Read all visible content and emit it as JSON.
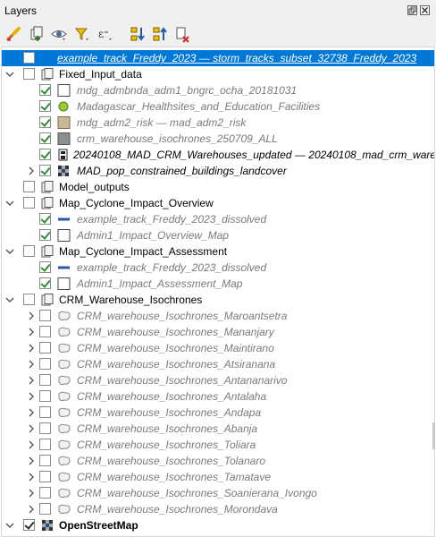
{
  "panel": {
    "title": "Layers"
  },
  "colors": {
    "selection": "#0078d7",
    "group_text": "#000000",
    "hidden_layer_text": "#7a7a7a"
  },
  "toolbar": {
    "tools": [
      {
        "name": "style-brush-icon"
      },
      {
        "name": "add-group-icon"
      },
      {
        "name": "visibility-eye-icon"
      },
      {
        "name": "filter-icon"
      },
      {
        "name": "expression-filter-icon"
      },
      {
        "name": "expand-all-icon"
      },
      {
        "name": "collapse-all-icon"
      },
      {
        "name": "remove-layer-icon"
      }
    ]
  },
  "tree": {
    "rows": [
      {
        "label": "example_track_Freddy_2023 — storm_tracks_subset_32738_Freddy_2023",
        "selected": true
      },
      {
        "label": "Fixed_Input_data"
      },
      {
        "label": "mdg_admbnda_adm1_bngrc_ocha_20181031"
      },
      {
        "label": "Madagascar_Healthsites_and_Education_Facilities"
      },
      {
        "label": "mdg_adm2_risk — mad_adm2_risk"
      },
      {
        "label": "crm_warehouse_isochrones_250709_ALL"
      },
      {
        "label": "20240108_MAD_CRM_Warehouses_updated — 20240108_mad_crm_warehouses_updated"
      },
      {
        "label": "MAD_pop_constrained_buildings_landcover"
      },
      {
        "label": "Model_outputs"
      },
      {
        "label": "Map_Cyclone_Impact_Overview"
      },
      {
        "label": "example_track_Freddy_2023_dissolved"
      },
      {
        "label": "Admin1_Impact_Overview_Map"
      },
      {
        "label": "Map_Cyclone_Impact_Assessment"
      },
      {
        "label": "example_track_Freddy_2023_dissolved"
      },
      {
        "label": "Admin1_Impact_Assessment_Map"
      },
      {
        "label": "CRM_Warehouse_Isochrones"
      },
      {
        "label": "CRM_warehouse_Isochrones_Maroantsetra"
      },
      {
        "label": "CRM_warehouse_Isochrones_Mananjary"
      },
      {
        "label": "CRM_warehouse_Isochrones_Maintirano"
      },
      {
        "label": "CRM_warehouse_Isochrones_Atsiranana"
      },
      {
        "label": "CRM_warehouse_Isochrones_Antananarivo"
      },
      {
        "label": "CRM_warehouse_Isochrones_Antalaha"
      },
      {
        "label": "CRM_warehouse_Isochrones_Andapa"
      },
      {
        "label": "CRM_warehouse_Isochrones_Abanja"
      },
      {
        "label": "CRM_warehouse_Isochrones_Toliara"
      },
      {
        "label": "CRM_warehouse_Isochrones_Tolanaro"
      },
      {
        "label": "CRM_warehouse_Isochrones_Tamatave"
      },
      {
        "label": "CRM_warehouse_Isochrones_Soanierana_Ivongo"
      },
      {
        "label": "CRM_warehouse_Isochrones_Morondava"
      },
      {
        "label": "OpenStreetMap"
      }
    ]
  }
}
